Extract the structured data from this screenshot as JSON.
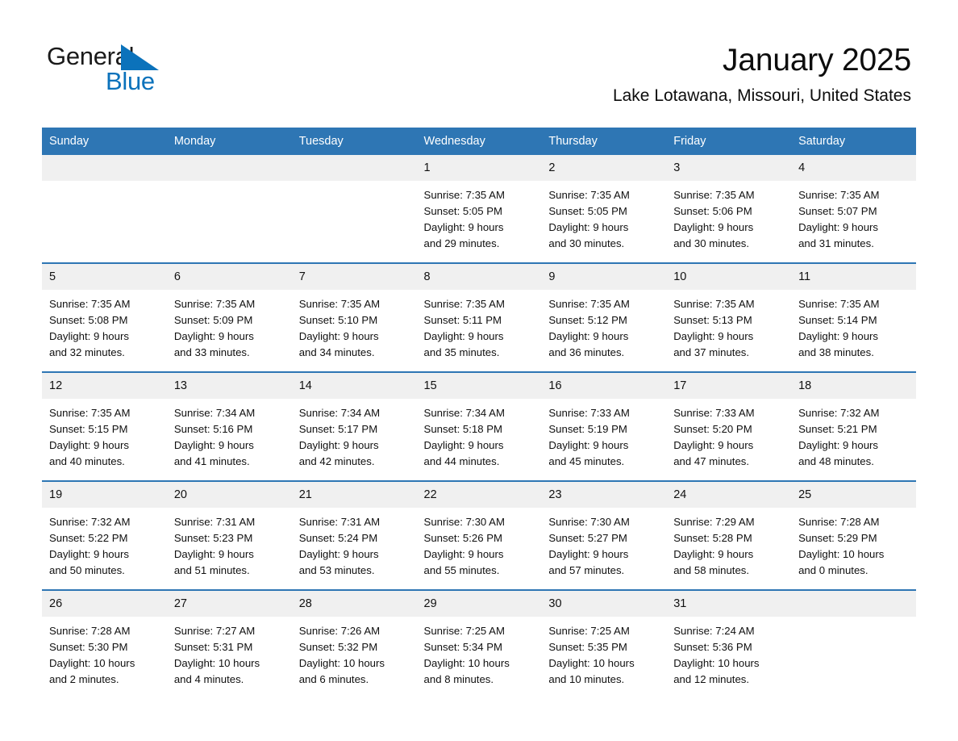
{
  "brand": {
    "name_part1": "General",
    "name_part2": "Blue",
    "accent_color": "#0b72bb",
    "header_color": "#2E76B4"
  },
  "header": {
    "month_title": "January 2025",
    "location": "Lake Lotawana, Missouri, United States"
  },
  "calendar": {
    "weekday_headers": [
      "Sunday",
      "Monday",
      "Tuesday",
      "Wednesday",
      "Thursday",
      "Friday",
      "Saturday"
    ],
    "weeks": [
      [
        {
          "day": "",
          "sunrise": "",
          "sunset": "",
          "daylight_line1": "",
          "daylight_line2": "",
          "blank": true
        },
        {
          "day": "",
          "sunrise": "",
          "sunset": "",
          "daylight_line1": "",
          "daylight_line2": "",
          "blank": true
        },
        {
          "day": "",
          "sunrise": "",
          "sunset": "",
          "daylight_line1": "",
          "daylight_line2": "",
          "blank": true
        },
        {
          "day": "1",
          "sunrise": "Sunrise: 7:35 AM",
          "sunset": "Sunset: 5:05 PM",
          "daylight_line1": "Daylight: 9 hours",
          "daylight_line2": "and 29 minutes."
        },
        {
          "day": "2",
          "sunrise": "Sunrise: 7:35 AM",
          "sunset": "Sunset: 5:05 PM",
          "daylight_line1": "Daylight: 9 hours",
          "daylight_line2": "and 30 minutes."
        },
        {
          "day": "3",
          "sunrise": "Sunrise: 7:35 AM",
          "sunset": "Sunset: 5:06 PM",
          "daylight_line1": "Daylight: 9 hours",
          "daylight_line2": "and 30 minutes."
        },
        {
          "day": "4",
          "sunrise": "Sunrise: 7:35 AM",
          "sunset": "Sunset: 5:07 PM",
          "daylight_line1": "Daylight: 9 hours",
          "daylight_line2": "and 31 minutes."
        }
      ],
      [
        {
          "day": "5",
          "sunrise": "Sunrise: 7:35 AM",
          "sunset": "Sunset: 5:08 PM",
          "daylight_line1": "Daylight: 9 hours",
          "daylight_line2": "and 32 minutes."
        },
        {
          "day": "6",
          "sunrise": "Sunrise: 7:35 AM",
          "sunset": "Sunset: 5:09 PM",
          "daylight_line1": "Daylight: 9 hours",
          "daylight_line2": "and 33 minutes."
        },
        {
          "day": "7",
          "sunrise": "Sunrise: 7:35 AM",
          "sunset": "Sunset: 5:10 PM",
          "daylight_line1": "Daylight: 9 hours",
          "daylight_line2": "and 34 minutes."
        },
        {
          "day": "8",
          "sunrise": "Sunrise: 7:35 AM",
          "sunset": "Sunset: 5:11 PM",
          "daylight_line1": "Daylight: 9 hours",
          "daylight_line2": "and 35 minutes."
        },
        {
          "day": "9",
          "sunrise": "Sunrise: 7:35 AM",
          "sunset": "Sunset: 5:12 PM",
          "daylight_line1": "Daylight: 9 hours",
          "daylight_line2": "and 36 minutes."
        },
        {
          "day": "10",
          "sunrise": "Sunrise: 7:35 AM",
          "sunset": "Sunset: 5:13 PM",
          "daylight_line1": "Daylight: 9 hours",
          "daylight_line2": "and 37 minutes."
        },
        {
          "day": "11",
          "sunrise": "Sunrise: 7:35 AM",
          "sunset": "Sunset: 5:14 PM",
          "daylight_line1": "Daylight: 9 hours",
          "daylight_line2": "and 38 minutes."
        }
      ],
      [
        {
          "day": "12",
          "sunrise": "Sunrise: 7:35 AM",
          "sunset": "Sunset: 5:15 PM",
          "daylight_line1": "Daylight: 9 hours",
          "daylight_line2": "and 40 minutes."
        },
        {
          "day": "13",
          "sunrise": "Sunrise: 7:34 AM",
          "sunset": "Sunset: 5:16 PM",
          "daylight_line1": "Daylight: 9 hours",
          "daylight_line2": "and 41 minutes."
        },
        {
          "day": "14",
          "sunrise": "Sunrise: 7:34 AM",
          "sunset": "Sunset: 5:17 PM",
          "daylight_line1": "Daylight: 9 hours",
          "daylight_line2": "and 42 minutes."
        },
        {
          "day": "15",
          "sunrise": "Sunrise: 7:34 AM",
          "sunset": "Sunset: 5:18 PM",
          "daylight_line1": "Daylight: 9 hours",
          "daylight_line2": "and 44 minutes."
        },
        {
          "day": "16",
          "sunrise": "Sunrise: 7:33 AM",
          "sunset": "Sunset: 5:19 PM",
          "daylight_line1": "Daylight: 9 hours",
          "daylight_line2": "and 45 minutes."
        },
        {
          "day": "17",
          "sunrise": "Sunrise: 7:33 AM",
          "sunset": "Sunset: 5:20 PM",
          "daylight_line1": "Daylight: 9 hours",
          "daylight_line2": "and 47 minutes."
        },
        {
          "day": "18",
          "sunrise": "Sunrise: 7:32 AM",
          "sunset": "Sunset: 5:21 PM",
          "daylight_line1": "Daylight: 9 hours",
          "daylight_line2": "and 48 minutes."
        }
      ],
      [
        {
          "day": "19",
          "sunrise": "Sunrise: 7:32 AM",
          "sunset": "Sunset: 5:22 PM",
          "daylight_line1": "Daylight: 9 hours",
          "daylight_line2": "and 50 minutes."
        },
        {
          "day": "20",
          "sunrise": "Sunrise: 7:31 AM",
          "sunset": "Sunset: 5:23 PM",
          "daylight_line1": "Daylight: 9 hours",
          "daylight_line2": "and 51 minutes."
        },
        {
          "day": "21",
          "sunrise": "Sunrise: 7:31 AM",
          "sunset": "Sunset: 5:24 PM",
          "daylight_line1": "Daylight: 9 hours",
          "daylight_line2": "and 53 minutes."
        },
        {
          "day": "22",
          "sunrise": "Sunrise: 7:30 AM",
          "sunset": "Sunset: 5:26 PM",
          "daylight_line1": "Daylight: 9 hours",
          "daylight_line2": "and 55 minutes."
        },
        {
          "day": "23",
          "sunrise": "Sunrise: 7:30 AM",
          "sunset": "Sunset: 5:27 PM",
          "daylight_line1": "Daylight: 9 hours",
          "daylight_line2": "and 57 minutes."
        },
        {
          "day": "24",
          "sunrise": "Sunrise: 7:29 AM",
          "sunset": "Sunset: 5:28 PM",
          "daylight_line1": "Daylight: 9 hours",
          "daylight_line2": "and 58 minutes."
        },
        {
          "day": "25",
          "sunrise": "Sunrise: 7:28 AM",
          "sunset": "Sunset: 5:29 PM",
          "daylight_line1": "Daylight: 10 hours",
          "daylight_line2": "and 0 minutes."
        }
      ],
      [
        {
          "day": "26",
          "sunrise": "Sunrise: 7:28 AM",
          "sunset": "Sunset: 5:30 PM",
          "daylight_line1": "Daylight: 10 hours",
          "daylight_line2": "and 2 minutes."
        },
        {
          "day": "27",
          "sunrise": "Sunrise: 7:27 AM",
          "sunset": "Sunset: 5:31 PM",
          "daylight_line1": "Daylight: 10 hours",
          "daylight_line2": "and 4 minutes."
        },
        {
          "day": "28",
          "sunrise": "Sunrise: 7:26 AM",
          "sunset": "Sunset: 5:32 PM",
          "daylight_line1": "Daylight: 10 hours",
          "daylight_line2": "and 6 minutes."
        },
        {
          "day": "29",
          "sunrise": "Sunrise: 7:25 AM",
          "sunset": "Sunset: 5:34 PM",
          "daylight_line1": "Daylight: 10 hours",
          "daylight_line2": "and 8 minutes."
        },
        {
          "day": "30",
          "sunrise": "Sunrise: 7:25 AM",
          "sunset": "Sunset: 5:35 PM",
          "daylight_line1": "Daylight: 10 hours",
          "daylight_line2": "and 10 minutes."
        },
        {
          "day": "31",
          "sunrise": "Sunrise: 7:24 AM",
          "sunset": "Sunset: 5:36 PM",
          "daylight_line1": "Daylight: 10 hours",
          "daylight_line2": "and 12 minutes."
        },
        {
          "day": "",
          "sunrise": "",
          "sunset": "",
          "daylight_line1": "",
          "daylight_line2": "",
          "blank": true
        }
      ]
    ]
  }
}
